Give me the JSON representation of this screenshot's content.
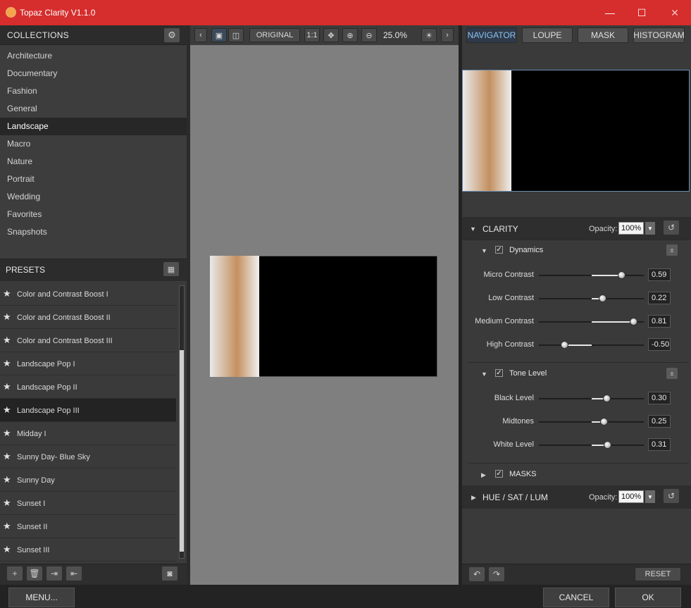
{
  "window": {
    "title": "Topaz Clarity V1.1.0",
    "minimize": "—",
    "maximize": "☐",
    "close": "✕"
  },
  "collections": {
    "header": "COLLECTIONS",
    "items": [
      "Architecture",
      "Documentary",
      "Fashion",
      "General",
      "Landscape",
      "Macro",
      "Nature",
      "Portrait",
      "Wedding",
      "Favorites",
      "Snapshots"
    ],
    "selected": "Landscape"
  },
  "presets": {
    "header": "PRESETS",
    "items": [
      "Color and Contrast Boost I",
      "Color and Contrast Boost II",
      "Color and Contrast Boost III",
      "Landscape Pop I",
      "Landscape Pop II",
      "Landscape Pop III",
      "Midday I",
      "Sunny Day- Blue Sky",
      "Sunny Day",
      "Sunset I",
      "Sunset II",
      "Sunset III"
    ],
    "selected": "Landscape Pop III"
  },
  "toolbar": {
    "original": "ORIGINAL",
    "one_to_one": "1:1",
    "zoom": "25.0%"
  },
  "right_tabs": [
    "NAVIGATOR",
    "LOUPE",
    "MASK",
    "HISTOGRAM"
  ],
  "clarity": {
    "title": "CLARITY",
    "opacity_label": "Opacity:",
    "opacity": "100%",
    "dynamics": {
      "title": "Dynamics",
      "sliders": [
        {
          "label": "Micro Contrast",
          "value": "0.59",
          "level": 0.59
        },
        {
          "label": "Low Contrast",
          "value": "0.22",
          "level": 0.22
        },
        {
          "label": "Medium Contrast",
          "value": "0.81",
          "level": 0.81
        },
        {
          "label": "High Contrast",
          "value": "-0.50",
          "level": -0.5
        }
      ]
    },
    "tone": {
      "title": "Tone Level",
      "sliders": [
        {
          "label": "Black Level",
          "value": "0.30",
          "level": 0.3
        },
        {
          "label": "Midtones",
          "value": "0.25",
          "level": 0.25
        },
        {
          "label": "White Level",
          "value": "0.31",
          "level": 0.31
        }
      ]
    },
    "masks": "MASKS"
  },
  "hsl": {
    "title": "HUE / SAT / LUM",
    "opacity_label": "Opacity:",
    "opacity": "100%"
  },
  "footer": {
    "reset": "RESET",
    "menu": "MENU...",
    "cancel": "CANCEL",
    "ok": "OK"
  },
  "colors": {
    "titlebar": "#d62d2d",
    "active_tab": "#8ec2ee"
  }
}
